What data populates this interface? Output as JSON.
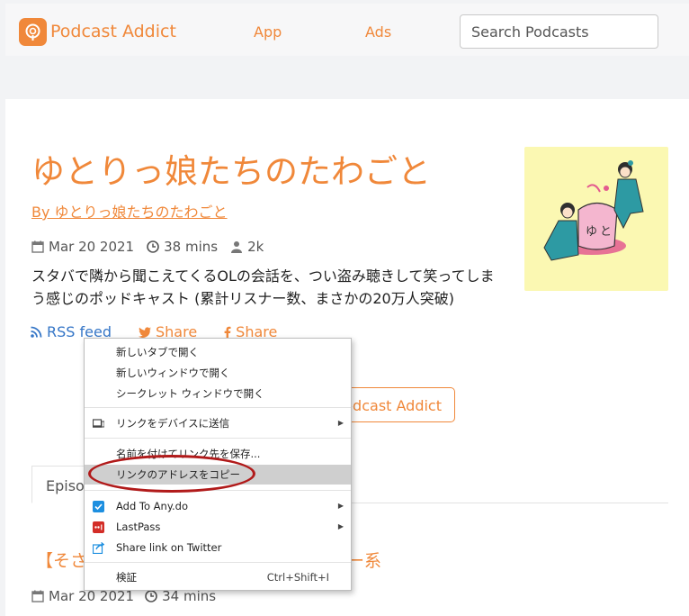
{
  "header": {
    "brand": "Podcast Addict",
    "nav": {
      "app": "App",
      "ads": "Ads"
    },
    "search_placeholder": "Search Podcasts"
  },
  "podcast": {
    "title": "ゆとりっ娘たちのたわごと",
    "author": "By ゆとりっ娘たちのたわごと",
    "date": "Mar 20 2021",
    "duration": "38 mins",
    "listeners": "2k",
    "description": "スタバで隣から聞こえてくるOLの会話を、つい盗み聴きして笑ってしまう感じのポッドキャスト (累計リスナー数、まさかの20万人突破)",
    "actions": {
      "rss": "RSS feed",
      "twitter_share": "Share",
      "facebook_share": "Share"
    },
    "open_button": "odcast Addict"
  },
  "tabs": {
    "episodes": "Episod"
  },
  "episode": {
    "title_start": "【そさ",
    "title_end": "ー系",
    "date": "Mar 20 2021",
    "duration": "34 mins"
  },
  "context_menu": {
    "items": [
      {
        "label": "新しいタブで開く"
      },
      {
        "label": "新しいウィンドウで開く"
      },
      {
        "label": "シークレット ウィンドウで開く"
      },
      {
        "label": "リンクをデバイスに送信",
        "submenu": true
      },
      {
        "label": "名前を付けてリンク先を保存..."
      },
      {
        "label": "リンクのアドレスをコピー",
        "selected": true
      },
      {
        "label": "Add To Any.do",
        "submenu": true
      },
      {
        "label": "LastPass",
        "submenu": true
      },
      {
        "label": "Share link on Twitter"
      },
      {
        "label": "検証",
        "shortcut": "Ctrl+Shift+I"
      }
    ]
  },
  "colors": {
    "accent": "#f0883a",
    "link": "#3576c7",
    "highlight_circle": "#b11a1a"
  }
}
